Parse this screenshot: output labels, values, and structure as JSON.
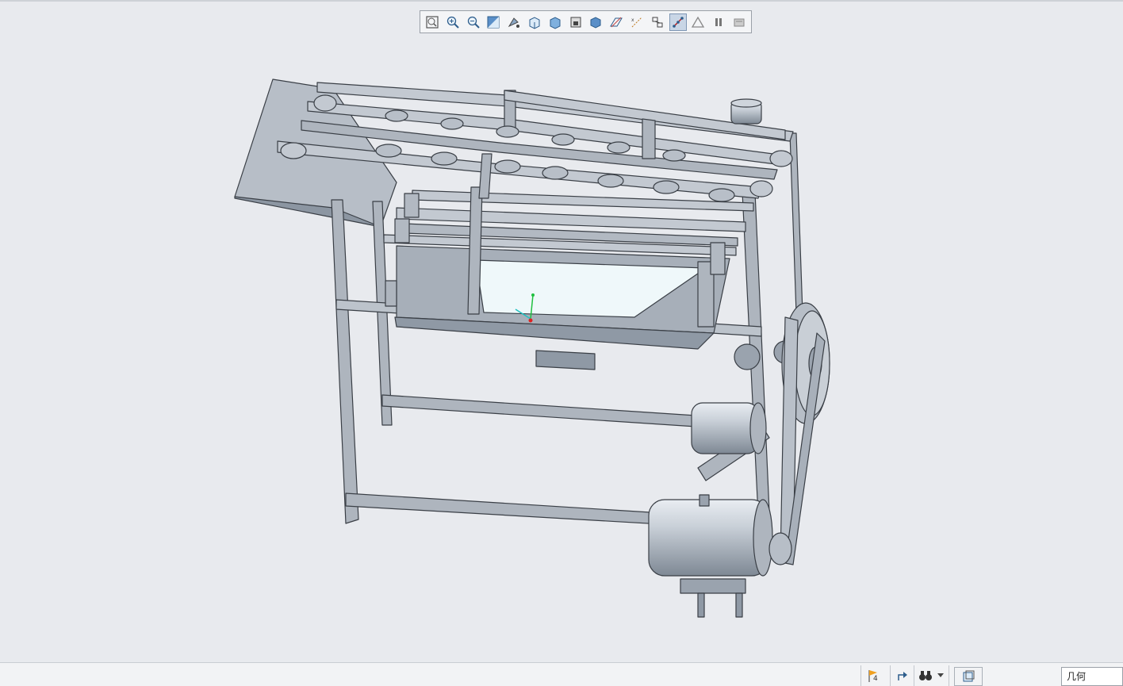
{
  "toolbar": {
    "buttons": [
      {
        "icon": "zoom-fit-icon"
      },
      {
        "icon": "zoom-in-icon"
      },
      {
        "icon": "zoom-out-icon"
      },
      {
        "icon": "repaint-icon"
      },
      {
        "icon": "reorient-icon"
      },
      {
        "icon": "saved-views-icon"
      },
      {
        "icon": "display-style-icon"
      },
      {
        "icon": "view-manager-icon"
      },
      {
        "icon": "perspective-icon"
      },
      {
        "icon": "datum-planes-icon"
      },
      {
        "icon": "datum-axes-icon"
      },
      {
        "icon": "point-display-icon"
      },
      {
        "icon": "csys-display-icon",
        "active": true
      },
      {
        "icon": "annotation-display-icon"
      },
      {
        "icon": "pause-icon"
      },
      {
        "icon": "spin-center-icon"
      }
    ]
  },
  "statusbar": {
    "flag_count": "4",
    "filter_value": "几何"
  },
  "colors": {
    "background": "#e8eaee",
    "model_body": "#c3c9d1",
    "model_shadow": "#7f8894",
    "model_edge": "#3a3f46",
    "csys_x": "#e02020",
    "csys_y": "#20c040",
    "csys_z": "#20c0c0"
  }
}
